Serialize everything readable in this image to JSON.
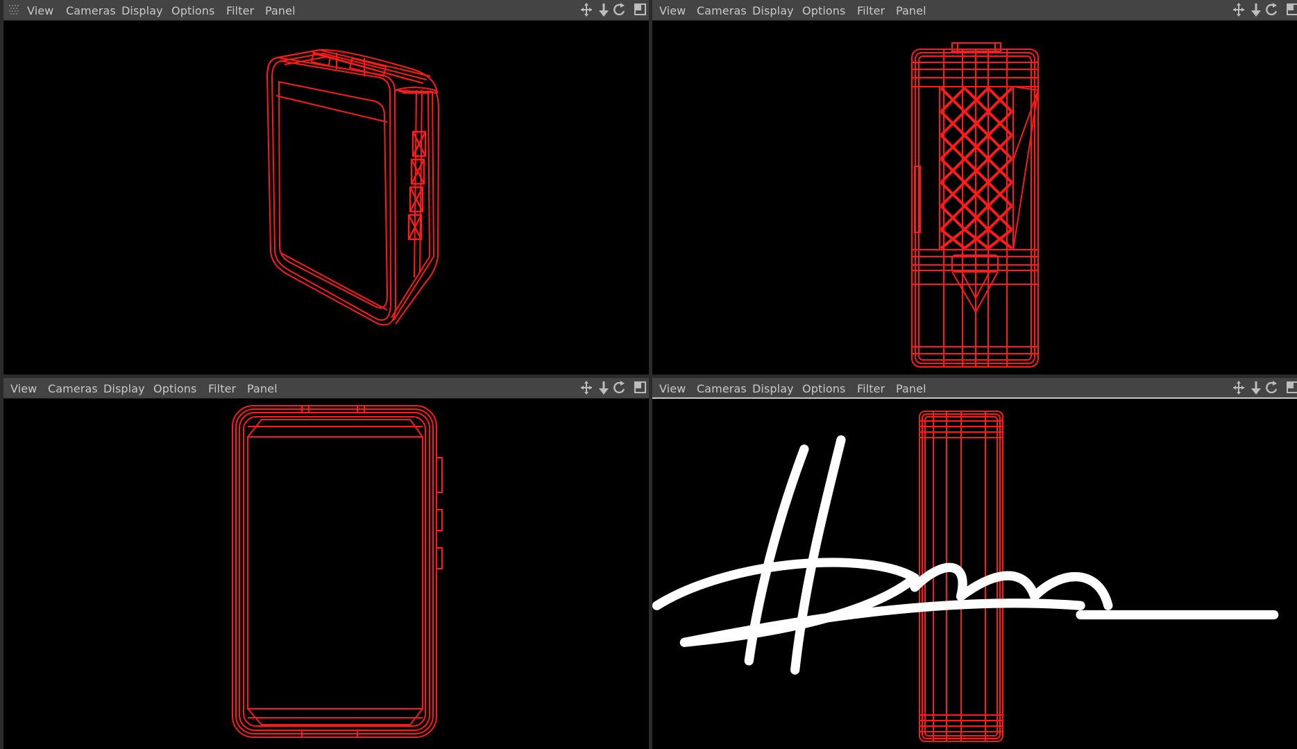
{
  "colors": {
    "menubar_bg": "#444444",
    "menu_text": "#c9c9c9",
    "viewport_bg": "#000000",
    "wire": "#ff1a1a",
    "window_bg": "#2b2b2b"
  },
  "icons": [
    "grip-icon",
    "pan-icon",
    "dolly-icon",
    "orbit-icon",
    "maximize-icon"
  ],
  "panels": [
    {
      "id": "top-left",
      "menu": [
        "View",
        "Cameras",
        "Display",
        "Options",
        "Filter",
        "Panel"
      ],
      "view": "perspective"
    },
    {
      "id": "top-right",
      "menu": [
        "View",
        "Cameras",
        "Display",
        "Options",
        "Filter",
        "Panel"
      ],
      "view": "back"
    },
    {
      "id": "bottom-left",
      "menu": [
        "View",
        "Cameras",
        "Display",
        "Options",
        "Filter",
        "Panel"
      ],
      "view": "front"
    },
    {
      "id": "bottom-right",
      "menu": [
        "View",
        "Cameras",
        "Display",
        "Options",
        "Filter",
        "Panel"
      ],
      "view": "side",
      "active": true
    }
  ]
}
